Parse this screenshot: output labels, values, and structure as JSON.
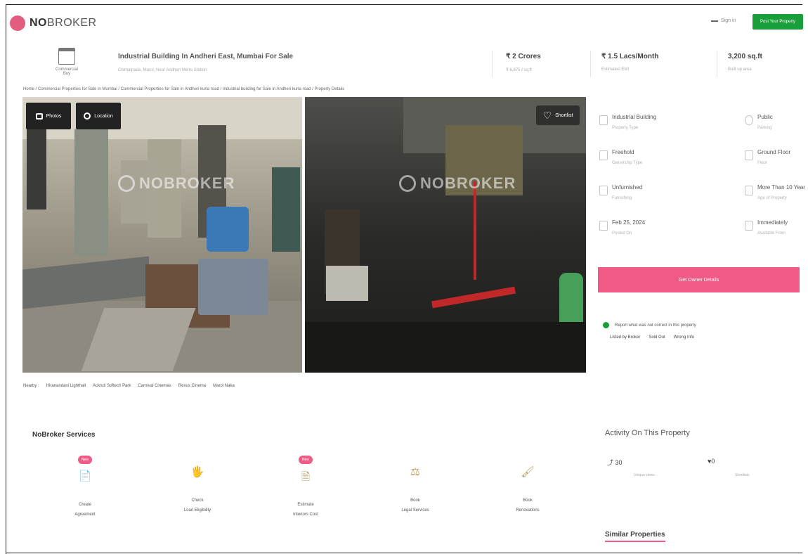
{
  "header": {
    "logo_no": "NO",
    "logo_broker": "BROKER",
    "menu_label": "Sign in",
    "post_button": "Post Your Property"
  },
  "listing": {
    "category_label": "Commercial Buy",
    "title": "Industrial Building In Andheri East, Mumbai For Sale",
    "subtitle": "Chimatpada, Marol, Near Andheri Metro Station",
    "price": {
      "value": "₹ 2 Crores",
      "label": "₹ 6,875 / sq.ft"
    },
    "emi": {
      "value": "₹ 1.5 Lacs/Month",
      "label": "Estimated EMI"
    },
    "area": {
      "value": "3,200 sq.ft",
      "label": "Built up area"
    }
  },
  "breadcrumb": "Home / Commercial Properties for Sale in Mumbai / Commercial Properties for Sale in Andheri kurla road / Industrial building for Sale in Andheri kurla road / Property Details",
  "gallery": {
    "photos_button": "Photos",
    "location_button": "Location",
    "shortlist_button": "Shortlist",
    "watermark": "NOBROKER"
  },
  "nearby": {
    "label": "Nearby :",
    "items": [
      "Hiranandani Lighthall",
      "Ackruti Softech Park",
      "Carnival Cinemas",
      "Rexus Cinema",
      "Marol Naka"
    ]
  },
  "overview": [
    {
      "value": "Industrial Building",
      "label": "Property Type"
    },
    {
      "value": "Public",
      "label": "Parking"
    },
    {
      "value": "Freehold",
      "label": "Ownership Type"
    },
    {
      "value": "Ground Floor",
      "label": "Floor"
    },
    {
      "value": "Unfurnished",
      "label": "Furnishing"
    },
    {
      "value": "More Than 10 Year",
      "label": "Age of Property"
    },
    {
      "value": "Feb 25, 2024",
      "label": "Posted On"
    },
    {
      "value": "Immediately",
      "label": "Available From"
    }
  ],
  "owner_button": "Get Owner Details",
  "report": {
    "text": "Report what was not correct in this property",
    "options": [
      "Listed by Broker",
      "Sold Out",
      "Wrong Info"
    ]
  },
  "services": {
    "title": "NoBroker Services",
    "new_badge": "New",
    "items": [
      {
        "line1": "Create",
        "line2": "Agreement",
        "icon": "📄",
        "is_new": true
      },
      {
        "line1": "Check",
        "line2": "Loan Eligibility",
        "icon": "🖐",
        "is_new": false
      },
      {
        "line1": "Estimate",
        "line2": "Interiors Cost",
        "icon": "🗎",
        "is_new": true
      },
      {
        "line1": "Book",
        "line2": "Legal Services",
        "icon": "⚖",
        "is_new": false
      },
      {
        "line1": "Book",
        "line2": "Renovations",
        "icon": "🖌",
        "is_new": false
      }
    ]
  },
  "activity": {
    "title": "Activity On This Property",
    "views": "30",
    "views_label": "Unique views",
    "likes": "0",
    "likes_label": "Shortlists"
  },
  "similar_title": "Similar Properties",
  "colors": {
    "brand": "#f05a86",
    "green": "#1a9e3a"
  }
}
